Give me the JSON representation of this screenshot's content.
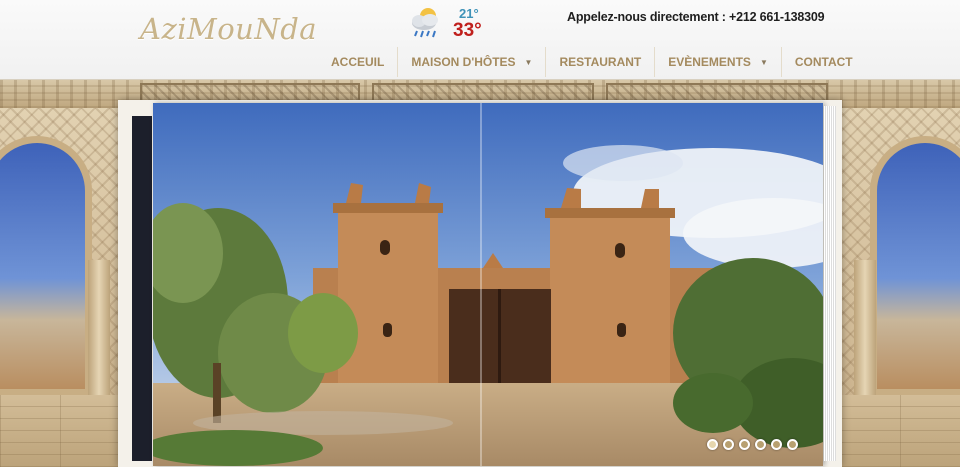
{
  "header": {
    "logo_text": "AziMouNda",
    "weather": {
      "icon": "rain-cloud-icon",
      "temp_low": "21°",
      "temp_high": "33°"
    },
    "contact": "Appelez-nous directement : +212 661-138309"
  },
  "nav": {
    "items": [
      {
        "label": "ACCEUIL",
        "has_submenu": false
      },
      {
        "label": "MAISON D'HÔTES",
        "has_submenu": true
      },
      {
        "label": "RESTAURANT",
        "has_submenu": false
      },
      {
        "label": "EVÈNEMENTS",
        "has_submenu": true
      },
      {
        "label": "CONTACT",
        "has_submenu": false
      }
    ]
  },
  "slideshow": {
    "slide_count": 6,
    "active_index": 0
  },
  "colors": {
    "accent": "#a48a5e",
    "temp_high": "#c0201d",
    "temp_low": "#3f93b8"
  }
}
